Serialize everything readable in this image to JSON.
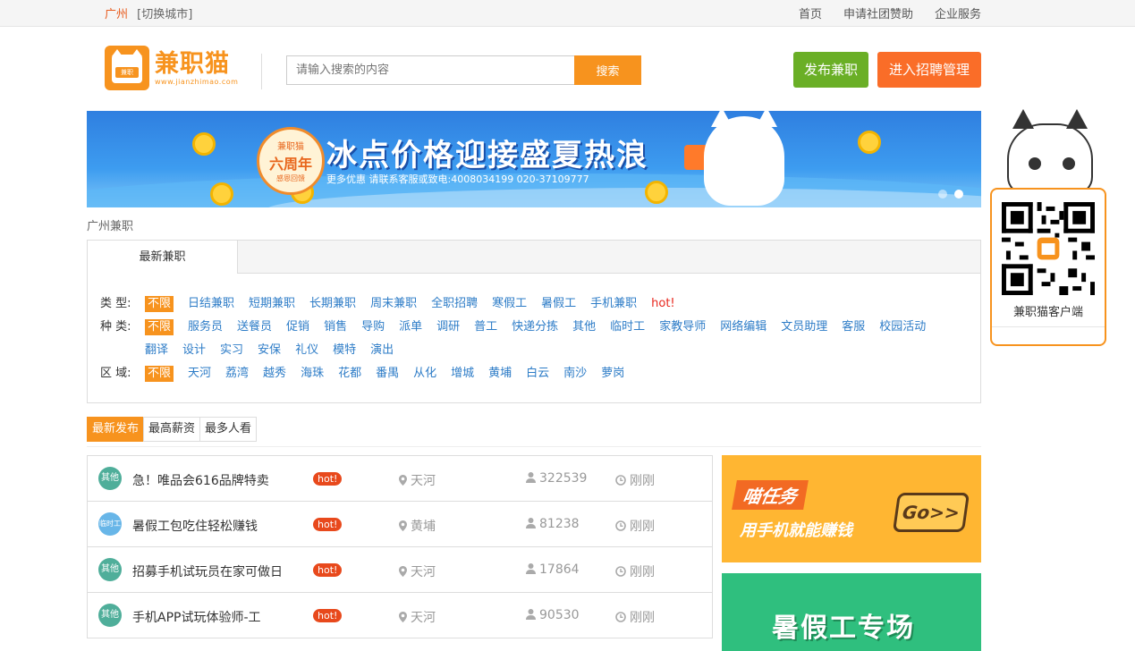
{
  "topbar": {
    "city": "广州",
    "switch_city": "[切换城市]",
    "links": [
      "首页",
      "申请社团赞助",
      "企业服务"
    ]
  },
  "header": {
    "logo_text": "兼职猫",
    "logo_url": "www.jianzhimao.com",
    "logo_badge": "兼职",
    "search_placeholder": "请输入搜索的内容",
    "search_button": "搜索",
    "publish_button": "发布兼职",
    "manage_button": "进入招聘管理"
  },
  "banner": {
    "badge_top": "兼职猫",
    "badge_main": "六周年",
    "badge_bottom": "感恩回馈",
    "headline": "冰点价格迎接盛夏热浪",
    "subline": "更多优惠 请联系客服或致电:4008034199 020-37109777"
  },
  "breadcrumb": "广州兼职",
  "filter": {
    "tab": "最新兼职",
    "rows": [
      {
        "label": "类  型:",
        "options": [
          "不限",
          "日结兼职",
          "短期兼职",
          "长期兼职",
          "周末兼职",
          "全职招聘",
          "寒假工",
          "暑假工",
          "手机兼职"
        ],
        "hot": "hot!"
      },
      {
        "label": "种  类:",
        "options": [
          "不限",
          "服务员",
          "送餐员",
          "促销",
          "销售",
          "导购",
          "派单",
          "调研",
          "普工",
          "快递分拣",
          "其他",
          "临时工",
          "家教导师",
          "网络编辑",
          "文员助理",
          "客服",
          "校园活动",
          "翻译",
          "设计",
          "实习",
          "安保",
          "礼仪",
          "模特",
          "演出"
        ]
      },
      {
        "label": "区  域:",
        "options": [
          "不限",
          "天河",
          "荔湾",
          "越秀",
          "海珠",
          "花都",
          "番禺",
          "从化",
          "增城",
          "黄埔",
          "白云",
          "南沙",
          "萝岗"
        ]
      }
    ]
  },
  "sort_tabs": [
    "最新发布",
    "最高薪资",
    "最多人看"
  ],
  "jobs": [
    {
      "cat": "其他",
      "title": "急！唯品会616品牌特卖",
      "hot": "hot!",
      "area": "天河",
      "views": "322539",
      "time": "刚刚"
    },
    {
      "cat": "临时工",
      "title": "暑假工包吃住轻松赚钱",
      "hot": "hot!",
      "area": "黄埔",
      "views": "81238",
      "time": "刚刚"
    },
    {
      "cat": "其他",
      "title": "招募手机试玩员在家可做日",
      "hot": "hot!",
      "area": "天河",
      "views": "17864",
      "time": "刚刚"
    },
    {
      "cat": "其他",
      "title": "手机APP试玩体验师-工",
      "hot": "hot!",
      "area": "天河",
      "views": "90530",
      "time": "刚刚"
    }
  ],
  "ads": {
    "ad1_title": "喵任务",
    "ad1_sub": "用手机就能赚钱",
    "ad1_go": "Go>>",
    "ad2_title": "暑假工专场"
  },
  "qr": {
    "caption": "兼职猫客户端"
  },
  "colors": {
    "accent": "#f7931e",
    "green": "#6aaf26",
    "orange_btn": "#fa6d28",
    "link": "#2d7cc7"
  }
}
